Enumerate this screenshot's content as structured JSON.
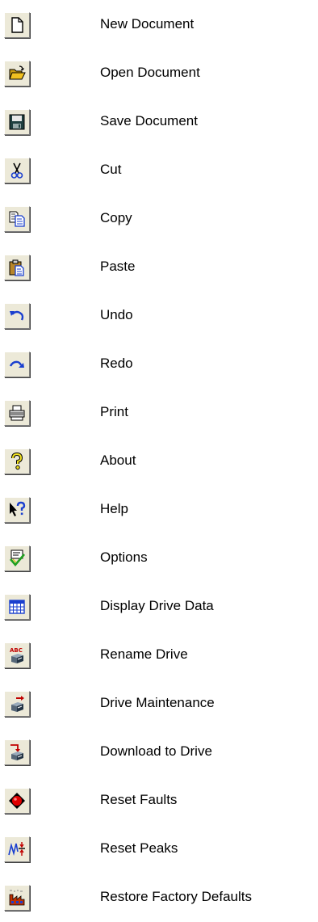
{
  "items": [
    {
      "label": "New Document",
      "icon": "new-document-icon"
    },
    {
      "label": "Open Document",
      "icon": "open-folder-icon"
    },
    {
      "label": "Save Document",
      "icon": "floppy-disk-icon"
    },
    {
      "label": "Cut",
      "icon": "scissors-icon"
    },
    {
      "label": "Copy",
      "icon": "copy-pages-icon"
    },
    {
      "label": "Paste",
      "icon": "clipboard-paste-icon"
    },
    {
      "label": "Undo",
      "icon": "undo-arrow-icon"
    },
    {
      "label": "Redo",
      "icon": "redo-arrow-icon"
    },
    {
      "label": "Print",
      "icon": "printer-icon"
    },
    {
      "label": "About",
      "icon": "question-mark-icon"
    },
    {
      "label": "Help",
      "icon": "pointer-question-icon"
    },
    {
      "label": "Options",
      "icon": "options-checkmark-icon"
    },
    {
      "label": "Display Drive Data",
      "icon": "data-grid-icon"
    },
    {
      "label": "Rename Drive",
      "icon": "abc-drive-icon"
    },
    {
      "label": "Drive Maintenance",
      "icon": "drive-maintenance-icon"
    },
    {
      "label": "Download to Drive",
      "icon": "download-drive-icon"
    },
    {
      "label": "Reset Faults",
      "icon": "red-light-icon"
    },
    {
      "label": "Reset Peaks",
      "icon": "reset-peaks-icon"
    },
    {
      "label": "Restore Factory Defaults",
      "icon": "factory-icon"
    }
  ],
  "colors": {
    "button_face": "#ece9d8",
    "accent_blue": "#1a3fcf",
    "folder_yellow": "#f0c020",
    "fault_red": "#e00000"
  }
}
